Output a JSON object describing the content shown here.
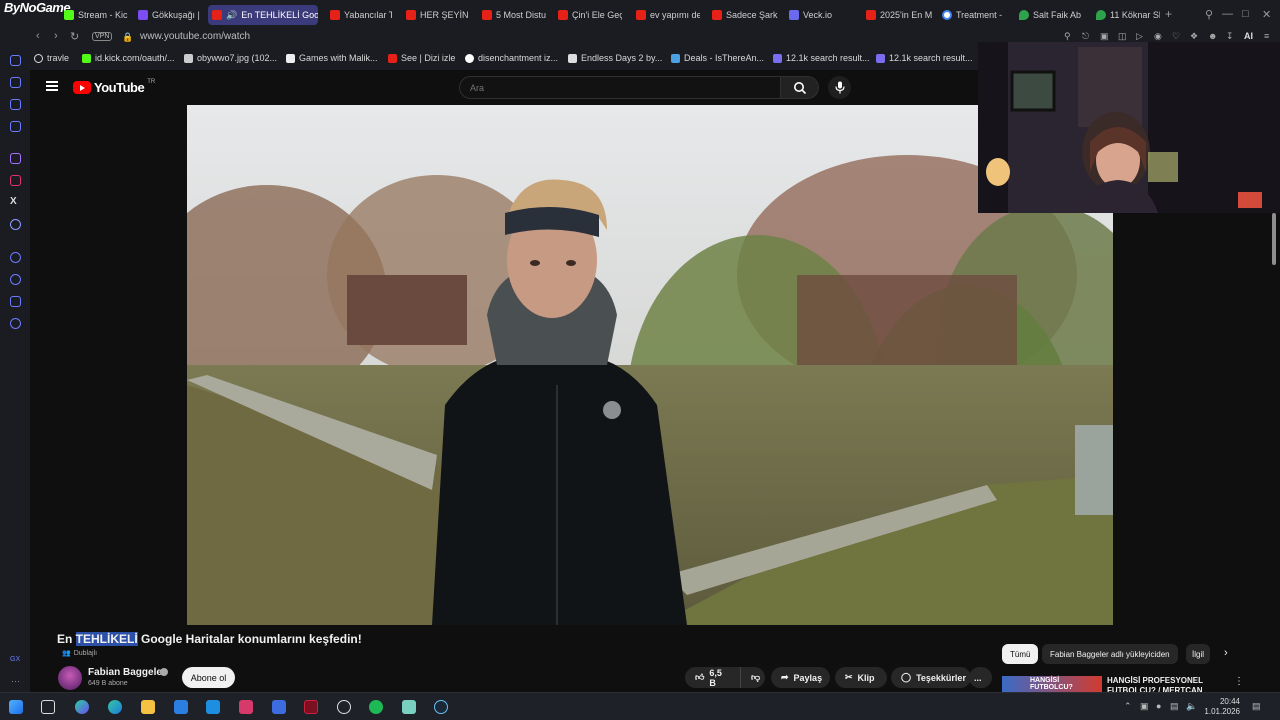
{
  "browser": {
    "logo_text": "ByNoGame",
    "tabs": [
      {
        "label": "Stream - Kick",
        "icon": "kick-icon"
      },
      {
        "label": "Gökkuşağı |",
        "icon": "twitch-icon"
      },
      {
        "label": "En TEHLİKELİ Goo",
        "icon": "youtube-icon",
        "active": true
      },
      {
        "label": "Yabancılar T",
        "icon": "youtube-icon"
      },
      {
        "label": "HER ŞEYİN",
        "icon": "youtube-icon"
      },
      {
        "label": "5 Most Distu",
        "icon": "youtube-icon"
      },
      {
        "label": "Çin'i Ele Geç",
        "icon": "youtube-icon"
      },
      {
        "label": "ev yapımı de",
        "icon": "youtube-icon"
      },
      {
        "label": "Sadece Şark",
        "icon": "youtube-icon"
      },
      {
        "label": "Veck.io",
        "icon": "veck-icon"
      },
      {
        "label": "2025'in En M",
        "icon": "youtube-icon"
      },
      {
        "label": "Treatment -",
        "icon": "google-icon"
      },
      {
        "label": "Salt Faik Ab",
        "icon": "maps-icon"
      },
      {
        "label": "11 Köknar Sk",
        "icon": "maps-icon"
      }
    ],
    "url": "www.youtube.com/watch",
    "vpn_label": "VPN",
    "bookmarks": [
      {
        "label": "travle"
      },
      {
        "label": "id.kick.com/oauth/..."
      },
      {
        "label": "obywwo7.jpg (102..."
      },
      {
        "label": "Games with Malik..."
      },
      {
        "label": "See | Dizi izle"
      },
      {
        "label": "disenchantment iz..."
      },
      {
        "label": "Endless Days 2 by..."
      },
      {
        "label": "Deals - IsThereAn..."
      },
      {
        "label": "12.1k search result..."
      },
      {
        "label": "12.1k search result..."
      }
    ],
    "ai_label": "AI"
  },
  "youtube": {
    "logo_word": "YouTube",
    "country_code": "TR",
    "search_placeholder": "Ara",
    "video_title_prefix": "En ",
    "video_title_highlight": "TEHLİKELİ",
    "video_title_suffix": " Google Haritalar konumlarını keşfedin!",
    "dubbed_label": "Dublajlı",
    "channel_name": "Fabian Baggeler",
    "subscriber_count": "649 B abone",
    "subscribe_label": "Abone ol",
    "like_count": "6,5 B",
    "share_label": "Paylaş",
    "clip_label": "Klip",
    "thanks_label": "Teşekkürler",
    "more_label": "...",
    "chips": [
      {
        "label": "Tümü",
        "selected": true
      },
      {
        "label": "Fabian Baggeler adlı yükleyiciden"
      },
      {
        "label": "İlgil"
      }
    ],
    "recommended_title": "HANGİSİ PROFESYONEL FUTBOLCU? / MERTCAN",
    "recommended_thumb_text": "HANGİSİ FUTBOLCU?"
  },
  "taskbar": {
    "time": "20:44",
    "date": "1.01.2026"
  },
  "colors": {
    "youtube_red": "#ff0000",
    "active_tab": "#3b3a7a",
    "background": "#0f0f0f"
  }
}
